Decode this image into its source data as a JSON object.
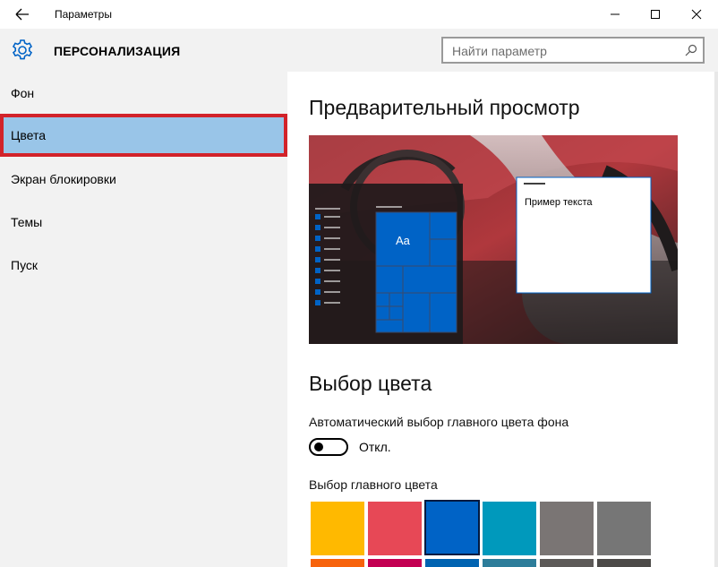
{
  "window": {
    "title": "Параметры",
    "controls": [
      "minimize",
      "maximize",
      "close"
    ]
  },
  "header": {
    "title": "ПЕРСОНАЛИЗАЦИЯ",
    "search_placeholder": "Найти параметр"
  },
  "sidebar": {
    "items": [
      {
        "label": "Фон",
        "selected": false
      },
      {
        "label": "Цвета",
        "selected": true
      },
      {
        "label": "Экран блокировки",
        "selected": false
      },
      {
        "label": "Темы",
        "selected": false
      },
      {
        "label": "Пуск",
        "selected": false
      }
    ]
  },
  "main": {
    "preview_heading": "Предварительный просмотр",
    "preview": {
      "sample_text": "Пример текста",
      "tile_label": "Aa"
    },
    "color_heading": "Выбор цвета",
    "auto_color_label": "Автоматический выбор главного цвета фона",
    "auto_color_toggle": {
      "state": "off",
      "label": "Откл."
    },
    "accent_label": "Выбор главного цвета",
    "swatches": [
      {
        "color": "#ffb900",
        "selected": false
      },
      {
        "color": "#e74856",
        "selected": false
      },
      {
        "color": "#0063c6",
        "selected": true
      },
      {
        "color": "#0099bc",
        "selected": false
      },
      {
        "color": "#7a7574",
        "selected": false
      },
      {
        "color": "#767676",
        "selected": false
      }
    ],
    "swatches_row2": [
      "#f7630c",
      "#c30052",
      "#0063b1",
      "#2d7d9a",
      "#5d5a58",
      "#4c4a48"
    ]
  },
  "colors": {
    "accent": "#0063c6",
    "sidebar_bg": "#f2f2f2",
    "selected_item_bg": "#99c5e8",
    "highlight_border": "#d2232a"
  }
}
